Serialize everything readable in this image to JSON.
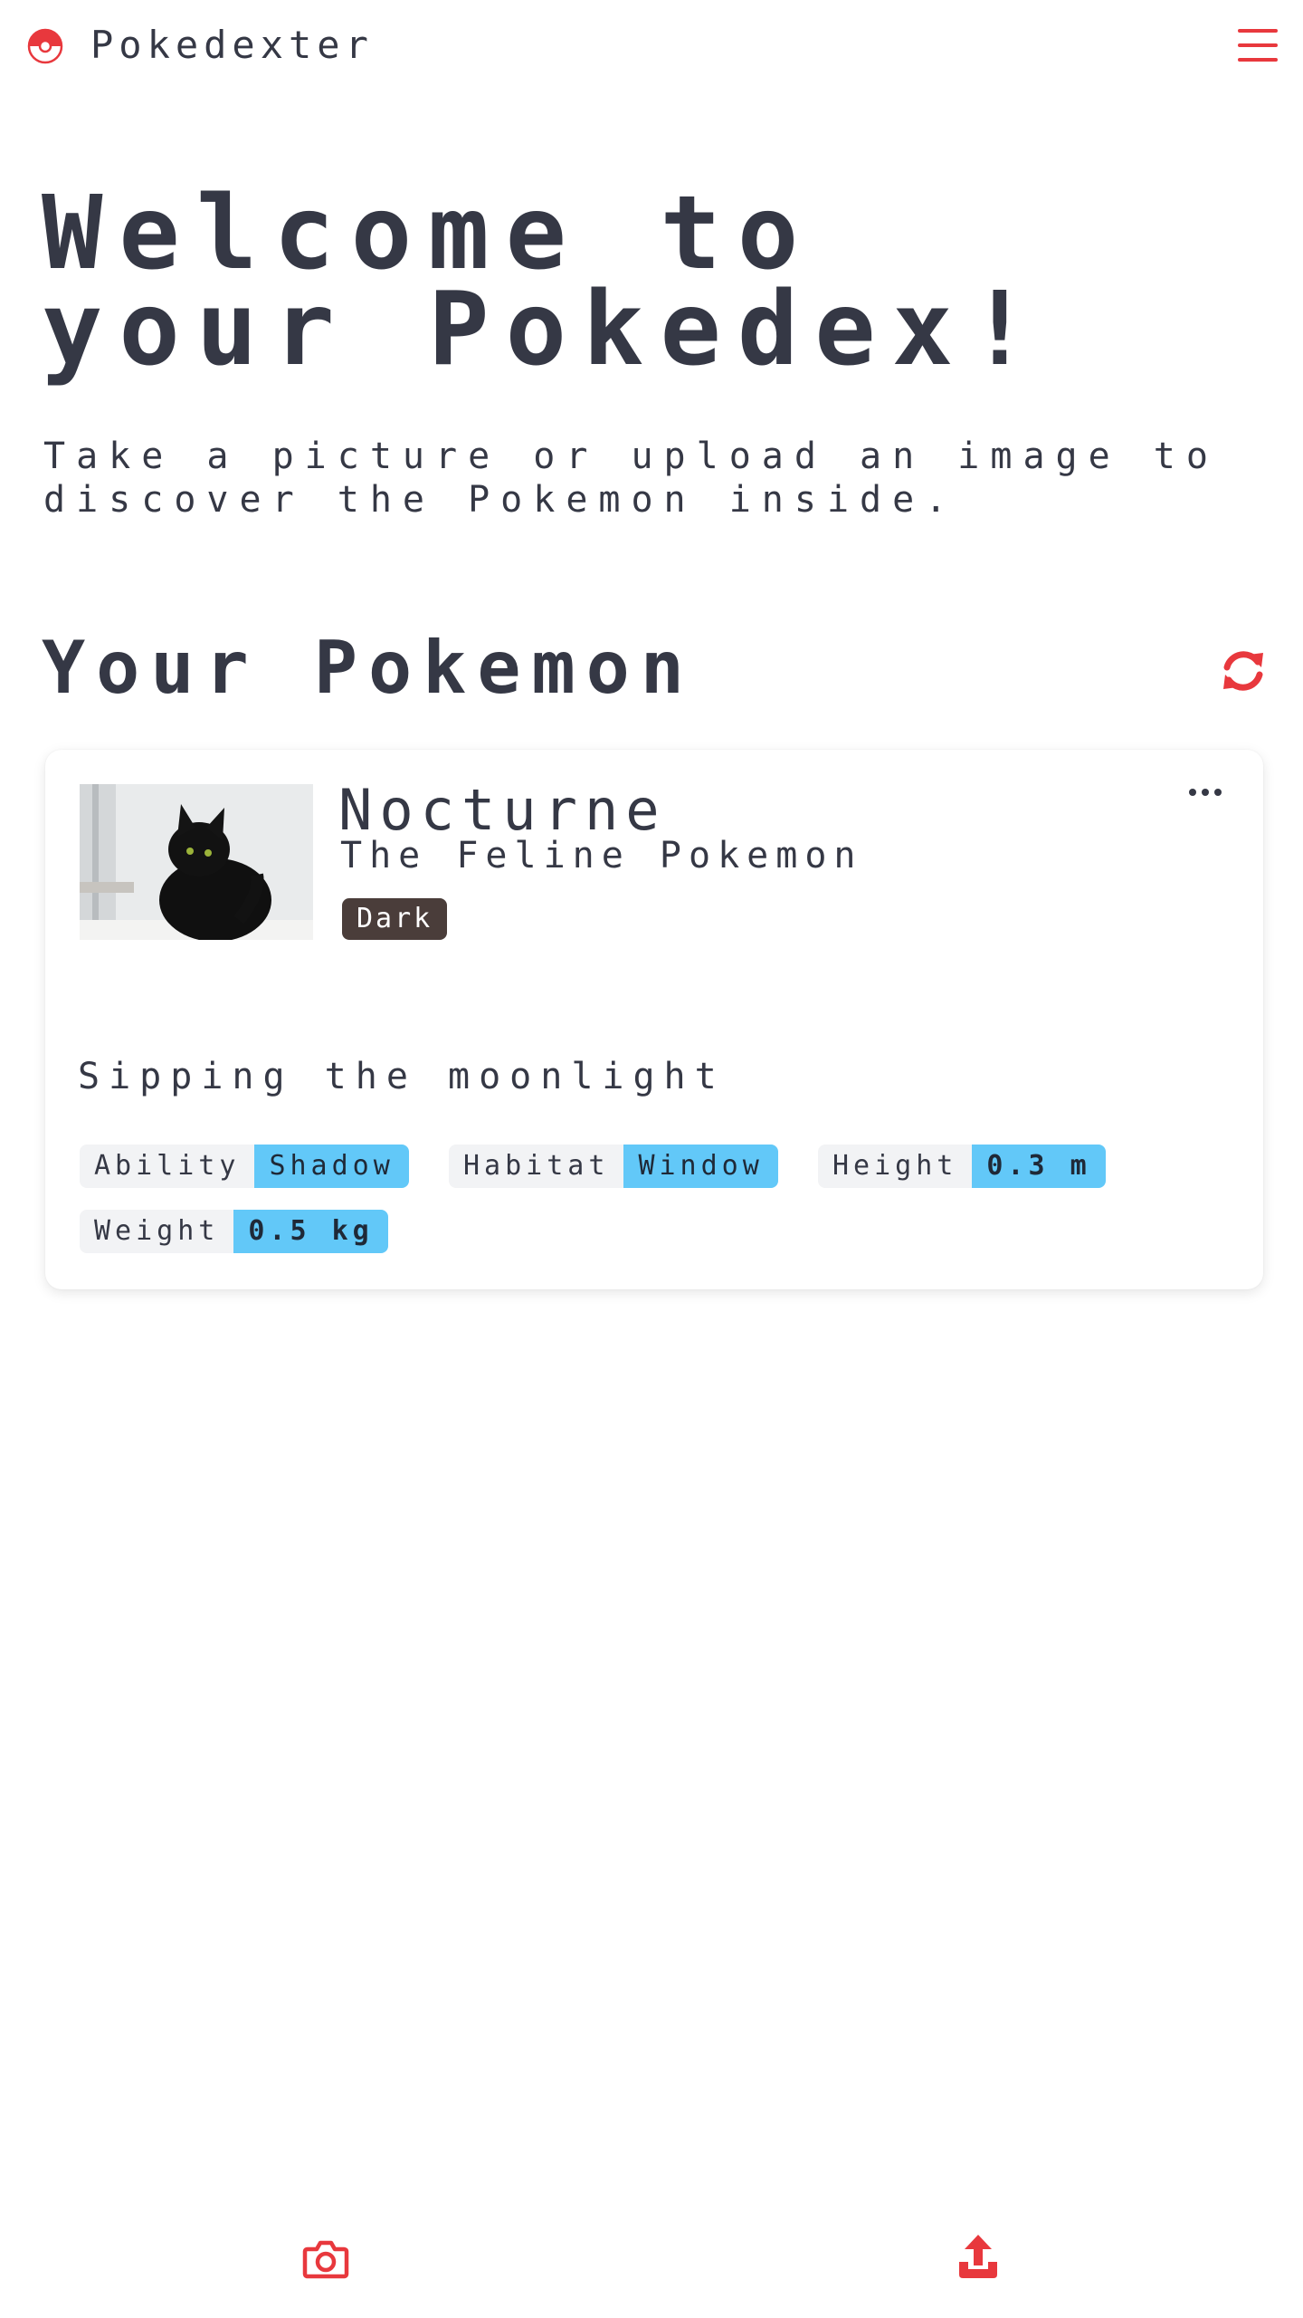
{
  "header": {
    "brand": "Pokedexter",
    "logo_icon": "pokeball-icon",
    "menu_icon": "hamburger-menu-icon"
  },
  "hero": {
    "title_line1": "Welcome to",
    "title_line2": "your Pokedex!",
    "subtitle_line1": "Take a picture or upload an image to",
    "subtitle_line2": "discover the Pokemon inside."
  },
  "section": {
    "title": "Your Pokemon",
    "refresh_icon": "refresh-icon"
  },
  "card": {
    "name": "Nocturne",
    "species": "The Feline Pokemon",
    "type": "Dark",
    "image_alt": "black cat photo",
    "description": "Sipping the moonlight",
    "more_icon": "more-options-icon",
    "stats": [
      {
        "label": "Ability",
        "value": "Shadow"
      },
      {
        "label": "Habitat",
        "value": "Window"
      },
      {
        "label": "Height",
        "value": "0.3 m"
      },
      {
        "label": "Weight",
        "value": "0.5 kg"
      }
    ]
  },
  "bottom_nav": {
    "camera_icon": "camera-icon",
    "upload_icon": "upload-icon"
  },
  "colors": {
    "accent": "#e8383d",
    "text": "#353845",
    "type_dark": "#4a3d3a",
    "stat_value": "#62c8f8",
    "stat_label": "#f2f3f5"
  }
}
